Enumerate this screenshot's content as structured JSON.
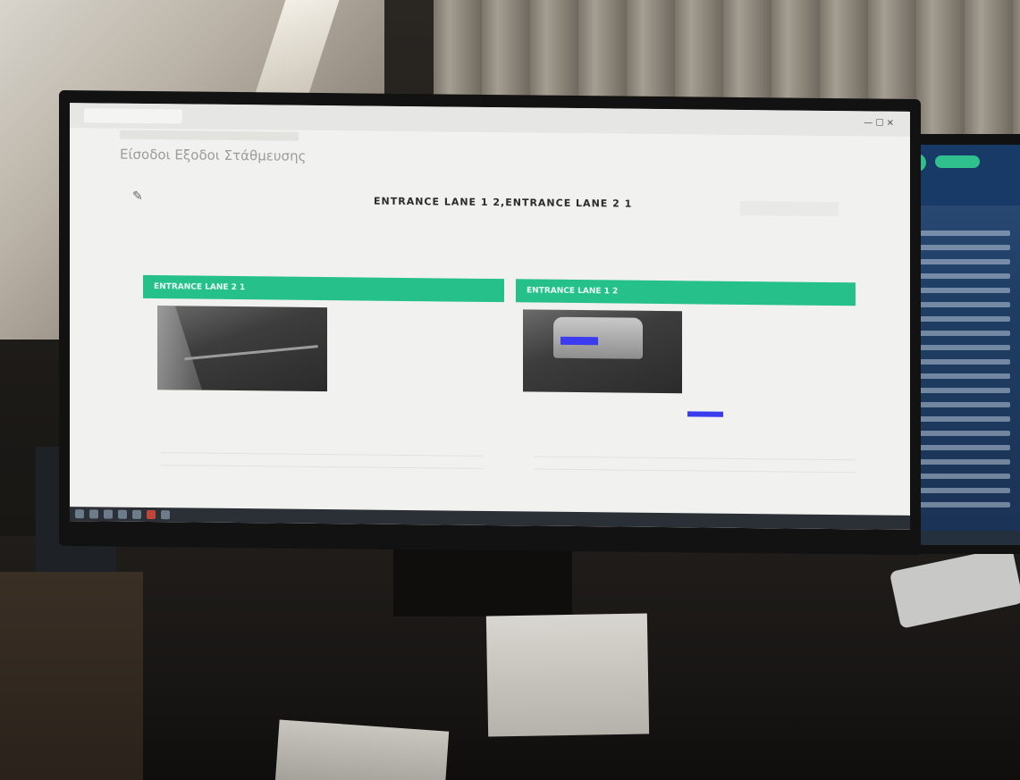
{
  "app": {
    "title": "Είσοδοι Εξοδοι Στάθμευσης",
    "subtitle": "",
    "page_heading": "ENTRANCE LANE 1 2,ENTRANCE LANE 2 1",
    "section_label": ""
  },
  "lanes": [
    {
      "title": "ENTRANCE LANE 2 1",
      "rows": [
        {
          "label": "",
          "value": ""
        },
        {
          "label": "",
          "value": ""
        },
        {
          "label": "",
          "value": ""
        },
        {
          "label": "",
          "value": ""
        },
        {
          "label": "",
          "value": ""
        }
      ],
      "action_label": ""
    },
    {
      "title": "ENTRANCE LANE 1 2",
      "rows": [
        {
          "label": "",
          "value": ""
        },
        {
          "label": "",
          "value": ""
        },
        {
          "label": "",
          "value": ""
        },
        {
          "label": "",
          "value": ""
        },
        {
          "label": "",
          "value": ""
        }
      ],
      "action_label": ""
    }
  ],
  "icons": {
    "edit": "pencil-icon"
  },
  "colors": {
    "lane_header": "#26c08a",
    "plate_highlight": "#3b3bf0"
  }
}
